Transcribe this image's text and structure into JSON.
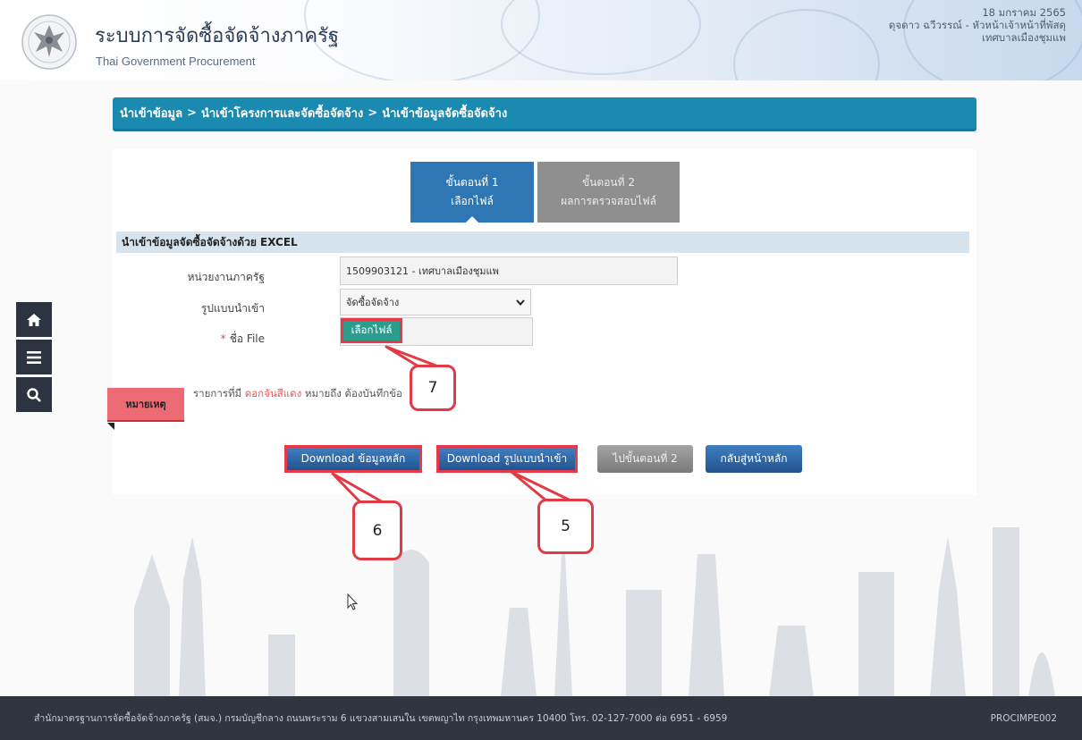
{
  "header": {
    "system_title": "ระบบการจัดซื้อจัดจ้างภาครัฐ",
    "system_subtitle": "Thai Government Procurement",
    "date": "18 มกราคม 2565",
    "user": "ดุจดาว ฉวีวรรณ์ - หัวหน้าเจ้าหน้าที่พัสดุ",
    "organization": "เทศบาลเมืองชุมแพ"
  },
  "side_nav": {
    "icons": [
      "home-icon",
      "menu-icon",
      "search-icon"
    ]
  },
  "breadcrumb": {
    "items": [
      "นำเข้าข้อมูล",
      "นำเข้าโครงการและจัดซื้อจัดจ้าง",
      "นำเข้าข้อมูลจัดซื้อจัดจ้าง"
    ],
    "separator": ">"
  },
  "steps": [
    {
      "title": "ขั้นตอนที่ 1",
      "label": "เลือกไฟล์",
      "active": true
    },
    {
      "title": "ขั้นตอนที่ 2",
      "label": "ผลการตรวจสอบไฟล์",
      "active": false
    }
  ],
  "form": {
    "section_title": "นำเข้าข้อมูลจัดซื้อจัดจ้างด้วย EXCEL",
    "agency_label": "หน่วยงานภาครัฐ",
    "agency_value": "1509903121 - เทศบาลเมืองชุมแพ",
    "format_label": "รูปแบบนำเข้า",
    "format_value": "จัดซื้อจัดจ้าง",
    "file_required_mark": "*",
    "file_label": "ชื่อ File",
    "choose_file_label": "เลือกไฟล์"
  },
  "note": {
    "tag": "หมายเหตุ",
    "text_before": "รายการที่มี",
    "text_red": "ดอกจันสีแดง",
    "text_after": "หมายถึง ต้องบันทึกข้อ"
  },
  "buttons": {
    "download_master": "Download ข้อมูลหลัก",
    "download_format": "Download รูปแบบนำเข้า",
    "next_step": "ไปขั้นตอนที่ 2",
    "back_home": "กลับสู่หน้าหลัก"
  },
  "callouts": [
    "7",
    "6",
    "5"
  ],
  "colors": {
    "accent": "#1a8ab0",
    "highlight": "#e8394a",
    "primary_button": "#2f77b4",
    "footer": "#2f363f"
  },
  "footer": {
    "address": "สำนักมาตรฐานการจัดซื้อจัดจ้างภาครัฐ (สมจ.) กรมบัญชีกลาง ถนนพระราม 6 แขวงสามเสนใน เขตพญาไท กรุงเทพมหานคร 10400 โทร. 02-127-7000 ต่อ 6951 - 6959",
    "page_code": "PROCIMPE002"
  }
}
